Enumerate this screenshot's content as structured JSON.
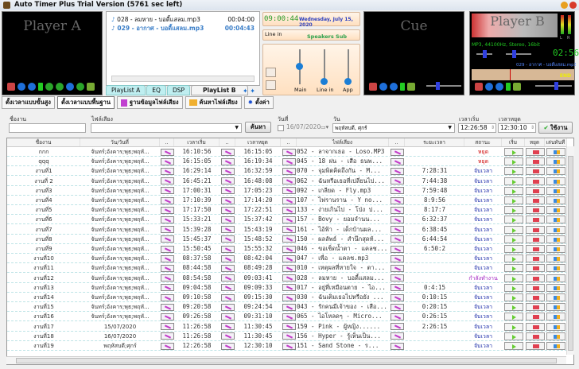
{
  "window": {
    "title": "Auto Timer Plus  Trial Version (5761 sec left)"
  },
  "player_a": {
    "title": "Player A"
  },
  "cue": {
    "title": "Cue"
  },
  "player_b": {
    "title": "Player B",
    "format": "MP3, 44100Hz, Stereo, 16bit",
    "time": "02:56",
    "track": "029 - อากาศ - บอดี้แสลม.mp3",
    "end_label": "END",
    "l": "L",
    "r": "R"
  },
  "playlist": {
    "items": [
      {
        "name": "028 - ลมหาย - บอดี้แสลม.mp3",
        "duration": "00:04:00"
      },
      {
        "name": "029 - อากาศ - บอดี้แสลม.mp3",
        "duration": "00:04:43"
      }
    ],
    "tabs": [
      "PlayList A",
      "EQ",
      "DSP",
      "PlayList B"
    ]
  },
  "mixer": {
    "clock": "09:00:44",
    "date": "Wednesday, July 15, 2020",
    "input": "Line in",
    "output": "Speakers Sub",
    "channels": [
      {
        "label": "Main",
        "level": 0.55
      },
      {
        "label": "Line in",
        "level": 0.05
      },
      {
        "label": "App",
        "level": 0.05
      }
    ]
  },
  "toolbar": [
    "ตั้งเวลาแบบขั้นสูง",
    "ตั้งเวลาแบบพื้นฐาน",
    "ฐานข้อมูลไฟล์เสียง",
    "ค้นหาไฟล์เสียง",
    "ตั้งค่า"
  ],
  "form": {
    "name_label": "ชื่องาน",
    "name_value": "",
    "file_label": "ไฟล์เสียง",
    "file_value": "",
    "search_button": "ค้นหา",
    "date_label": "วันที่",
    "date_value": "16/07/2020",
    "day_label": "วัน",
    "day_value": "พฤหัสบดี, ศุกร์",
    "start_label": "เวลาเริ่ม",
    "start_value": "12:26:58",
    "stop_label": "เวลาหยุด",
    "stop_value": "12:30:10",
    "apply_button": "ใช้งาน"
  },
  "table": {
    "headers": [
      "ชื่องาน",
      "วัน/วันที่",
      "..",
      "เวลาเริ่ม",
      "..",
      "เวลาหยุด",
      "..",
      "ไฟล์เสียง",
      "..",
      "ระยะเวลา",
      "สถานะ",
      "เริ่ม",
      "หยุด",
      "เล่นทันที"
    ],
    "status_colors": {
      "หยุด": "#d01010",
      "จับเวลา": "#1a2aa8",
      "กำลังทำงาน": "#a020c0"
    },
    "rows": [
      [
        "กกก",
        "จันทร์;อังคาร;พุธ;พฤหั...",
        "16:10:56",
        "16:15:05",
        "052 - ลาจากเธอ - Loso.MP3",
        "",
        "หยุด"
      ],
      [
        "qqq",
        "จันทร์;อังคาร;พุธ;พฤหั...",
        "16:15:05",
        "16:19:34",
        "045 - 18 ฝน - เสือ ธนพ...",
        "",
        "หยุด"
      ],
      [
        "งานที่1",
        "จันทร์;อังคาร;พุธ;พฤหั...",
        "16:29:14",
        "16:32:59",
        "070 - จุมพิตคิดถึงกัน - M...",
        "7:28:31",
        "จับเวลา"
      ],
      [
        "งานที่ 2",
        "จันทร์;อังคาร;พุธ;พฤหั...",
        "16:45:21",
        "16:48:08",
        "062 - ฉันหรือเธอที่เปลี่ยนไป...",
        "7:44:38",
        "จับเวลา"
      ],
      [
        "งานที่3",
        "จันทร์;อังคาร;พุธ;พฤหั...",
        "17:00:31",
        "17:05:23",
        "092 - เกลียด - Fly.mp3",
        "7:59:48",
        "จับเวลา"
      ],
      [
        "งานที่4",
        "จันทร์;อังคาร;พุธ;พฤหั...",
        "17:10:39",
        "17:14:20",
        "107 - ไฟรานราน - Y no...",
        "8:9:56",
        "จับเวลา"
      ],
      [
        "งานที่5",
        "จันทร์;อังคาร;พุธ;พฤหั...",
        "17:17:50",
        "17:22:51",
        "133 - ง่ายเกินไป - โป่ง ป...",
        "8:17:7",
        "จับเวลา"
      ],
      [
        "งานที่6",
        "จันทร์;อังคาร;พุธ;พฤหั...",
        "15:33:21",
        "15:37:42",
        "157 - Bovy - ยอมจำนน...",
        "6:32:37",
        "จับเวลา"
      ],
      [
        "งานที่7",
        "จันทร์;อังคาร;พุธ;พฤหั...",
        "15:39:28",
        "15:43:19",
        "161 - ไอ้ฟ้า - เด็กบ้านผล...",
        "6:38:45",
        "จับเวลา"
      ],
      [
        "งานที่8",
        "จันทร์;อังคาร;พุธ;พฤหั...",
        "15:45:37",
        "15:48:52",
        "150 - ผลลัพธ์ - สำนึกสุดท้...",
        "6:44:54",
        "จับเวลา"
      ],
      [
        "งานที่9",
        "จันทร์;อังคาร;พุธ;พฤหั...",
        "15:50:45",
        "15:55:32",
        "046 - ขอเช็ดน้ำตา - แคลช...",
        "6:50:2",
        "จับเวลา"
      ],
      [
        "งานที่10",
        "จันทร์;อังคาร;พุธ;พฤหั...",
        "08:37:58",
        "08:42:04",
        "047 - เพื่อ - แคลช.mp3",
        "",
        "จับเวลา"
      ],
      [
        "งานที่11",
        "จันทร์;อังคาร;พุธ;พฤหั...",
        "08:44:58",
        "08:49:28",
        "010 - เหตุผลที่หายใจ - ตา...",
        "",
        "จับเวลา"
      ],
      [
        "งานที่12",
        "จันทร์;อังคาร;พุธ;พฤหั...",
        "08:54:58",
        "09:03:41",
        "028 - ลมหาย - บอดี้แสลม...",
        "",
        "กำลังทำงาน"
      ],
      [
        "งานที่13",
        "จันทร์;อังคาร;พุธ;พฤหั...",
        "09:04:58",
        "09:09:33",
        "017 - อยู่ที่เหมือนตาย - ไอ...",
        "0:4:15",
        "จับเวลา"
      ],
      [
        "งานที่14",
        "จันทร์;อังคาร;พุธ;พฤหั...",
        "09:10:58",
        "09:15:30",
        "030 - ฉันเติมเธอไปหรือยัง ...",
        "0:10:15",
        "จับเวลา"
      ],
      [
        "งานที่15",
        "จันทร์;อังคาร;พุธ;พฤหั...",
        "09:20:58",
        "09:24:54",
        "043 - รักคนมีเจ้าของ - เสือ...",
        "0:20:15",
        "จับเวลา"
      ],
      [
        "งานที่16",
        "จันทร์;อังคาร;พุธ;พฤหั...",
        "09:26:58",
        "09:31:10",
        "065 - ไอโหลดๆ - Micro...",
        "0:26:15",
        "จับเวลา"
      ],
      [
        "งานที่17",
        "15/07/2020",
        "11:26:58",
        "11:30:45",
        "159 - Pink - ผู้หญิง......",
        "2:26:15",
        "จับเวลา"
      ],
      [
        "งานที่18",
        "16/07/2020",
        "11:26:58",
        "11:30:45",
        "156 - Hyper - รู้เห็นเป็น...",
        "",
        "จับเวลา"
      ],
      [
        "งานที่19",
        "พฤหัสบดี;ศุกร์",
        "12:26:58",
        "12:30:10",
        "151 - Sand Stone - ร...",
        "",
        "จับเวลา"
      ]
    ]
  }
}
